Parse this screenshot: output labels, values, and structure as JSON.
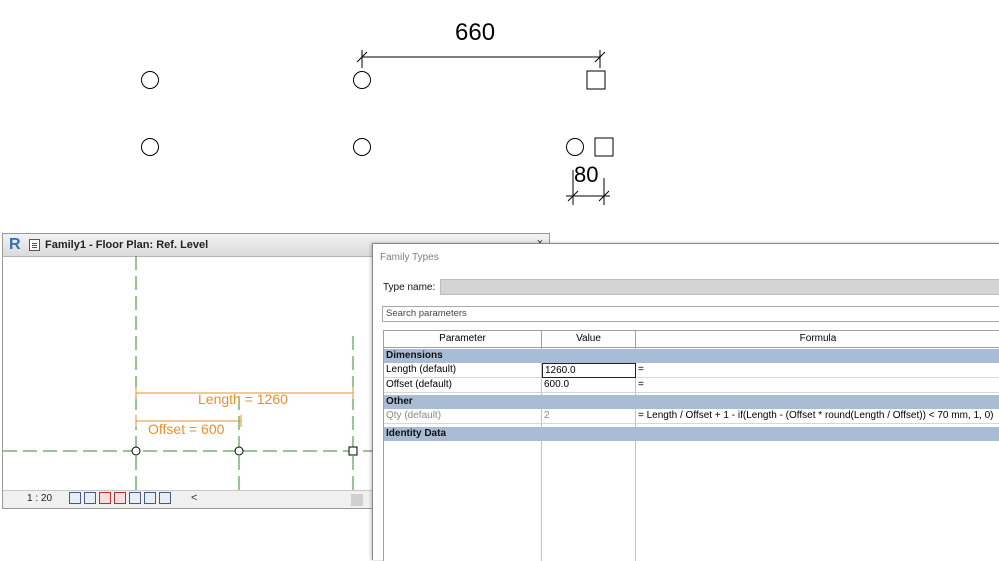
{
  "sketch": {
    "dim_top": "660",
    "dim_bottom": "80"
  },
  "plan_window": {
    "app_logo": "R",
    "title": "Family1 - Floor Plan: Ref. Level",
    "window_controls": "_ ×",
    "length_label": "Length = 1260",
    "offset_label": "Offset = 600",
    "scale": "1 : 20",
    "collapse_glyph": "<",
    "accent_color": "#e8902a",
    "refplane_color": "#2e8b2e"
  },
  "family_types": {
    "title": "Family Types",
    "type_name_label": "Type name:",
    "type_name_value": "",
    "search_placeholder": "Search parameters",
    "columns": {
      "parameter": "Parameter",
      "value": "Value",
      "formula": "Formula"
    },
    "groups": {
      "dimensions": "Dimensions",
      "other": "Other",
      "identity": "Identity Data"
    },
    "rows": {
      "length": {
        "parameter": "Length (default)",
        "value": "1260.0",
        "formula": "="
      },
      "offset": {
        "parameter": "Offset (default)",
        "value": "600.0",
        "formula": "="
      },
      "qty": {
        "parameter": "Qty (default)",
        "value": "2",
        "formula": "= Length / Offset + 1 - if(Length - (Offset * round(Length / Offset)) < 70 mm, 1, 0)"
      }
    },
    "group_header_color": "#a8bcd6"
  }
}
